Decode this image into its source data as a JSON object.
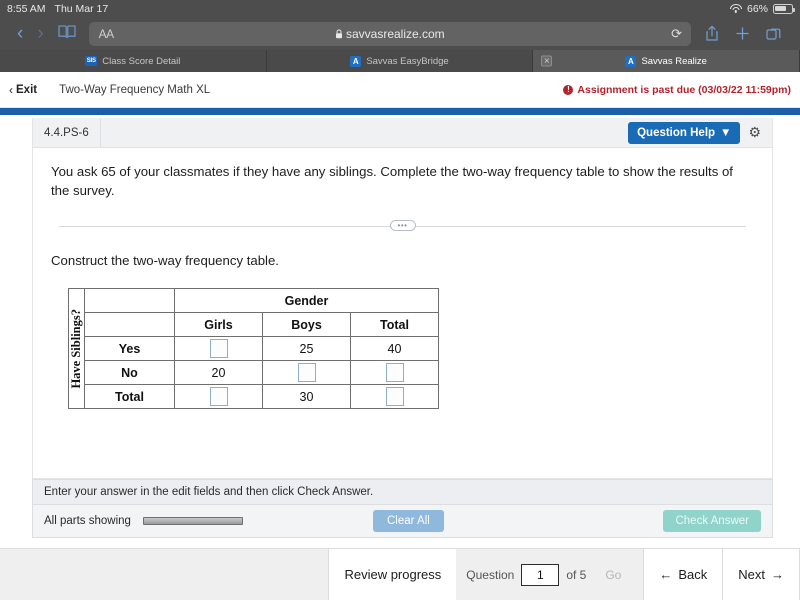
{
  "status_bar": {
    "time": "8:55 AM",
    "date": "Thu Mar 17",
    "wifi_icon": "wifi-icon",
    "battery_percent": "66%",
    "battery_icon": "battery-icon"
  },
  "browser": {
    "back_icon": "chevron-left-icon",
    "forward_icon": "chevron-right-icon",
    "bookmarks_icon": "book-icon",
    "text_size_label": "AA",
    "lock_icon": "lock-icon",
    "url": "savvasrealize.com",
    "reload_icon": "reload-icon",
    "share_icon": "share-icon",
    "new_tab_icon": "plus-icon",
    "tabs_icon": "tabs-icon"
  },
  "tabs": [
    {
      "label": "Class Score Detail",
      "favicon": "sis-favicon",
      "favicon_text": "SIS",
      "active": false,
      "closable": false
    },
    {
      "label": "Savvas EasyBridge",
      "favicon": "savvas-favicon",
      "favicon_text": "A",
      "active": false,
      "closable": false
    },
    {
      "label": "Savvas Realize",
      "favicon": "savvas-favicon",
      "favicon_text": "A",
      "active": true,
      "closable": true,
      "close_icon": "close-icon"
    }
  ],
  "app_header": {
    "exit_label": "Exit",
    "exit_chevron": "‹",
    "assignment_title": "Two-Way Frequency Math XL",
    "due_icon": "alert-icon",
    "due_icon_glyph": "!",
    "due_text": "Assignment is past due (03/03/22 11:59pm)"
  },
  "question_panel": {
    "question_id": "4.4.PS-6",
    "question_help_label": "Question Help",
    "question_help_caret": "▼",
    "settings_icon": "gear-icon",
    "settings_glyph": "⚙",
    "prompt": "You ask 65 of your classmates if they have any siblings. Complete the two-way frequency table to show the results of the survey.",
    "divider_handle": "•••",
    "subprompt": "Construct the two-way frequency table."
  },
  "frequency_table": {
    "row_axis_label": "Have Siblings?",
    "column_group_header": "Gender",
    "column_headers": [
      "Girls",
      "Boys",
      "Total"
    ],
    "rows": [
      {
        "label": "Yes",
        "cells": [
          "",
          "25",
          "40"
        ],
        "inputs": [
          true,
          false,
          false
        ]
      },
      {
        "label": "No",
        "cells": [
          "20",
          "",
          ""
        ],
        "inputs": [
          false,
          true,
          true
        ]
      },
      {
        "label": "Total",
        "cells": [
          "",
          "30",
          ""
        ],
        "inputs": [
          true,
          false,
          true
        ]
      }
    ]
  },
  "answer_bar": {
    "instruction": "Enter your answer in the edit fields and then click Check Answer.",
    "parts_status": "All parts showing",
    "clear_label": "Clear All",
    "check_label": "Check Answer"
  },
  "bottom_nav": {
    "review_label": "Review progress",
    "question_label": "Question",
    "question_value": "1",
    "of_label": "of 5",
    "go_label": "Go",
    "back_label": "Back",
    "back_icon": "arrow-left-icon",
    "back_arrow": "←",
    "next_label": "Next",
    "next_icon": "arrow-right-icon",
    "next_arrow": "→"
  },
  "colors": {
    "accent_blue": "#1a6bb5",
    "header_blue": "#1b5fa8",
    "due_red": "#b4222c",
    "clear_btn": "#8fb8dd",
    "check_btn": "#8fd3cb",
    "chrome_gray": "#4d4d4d"
  }
}
